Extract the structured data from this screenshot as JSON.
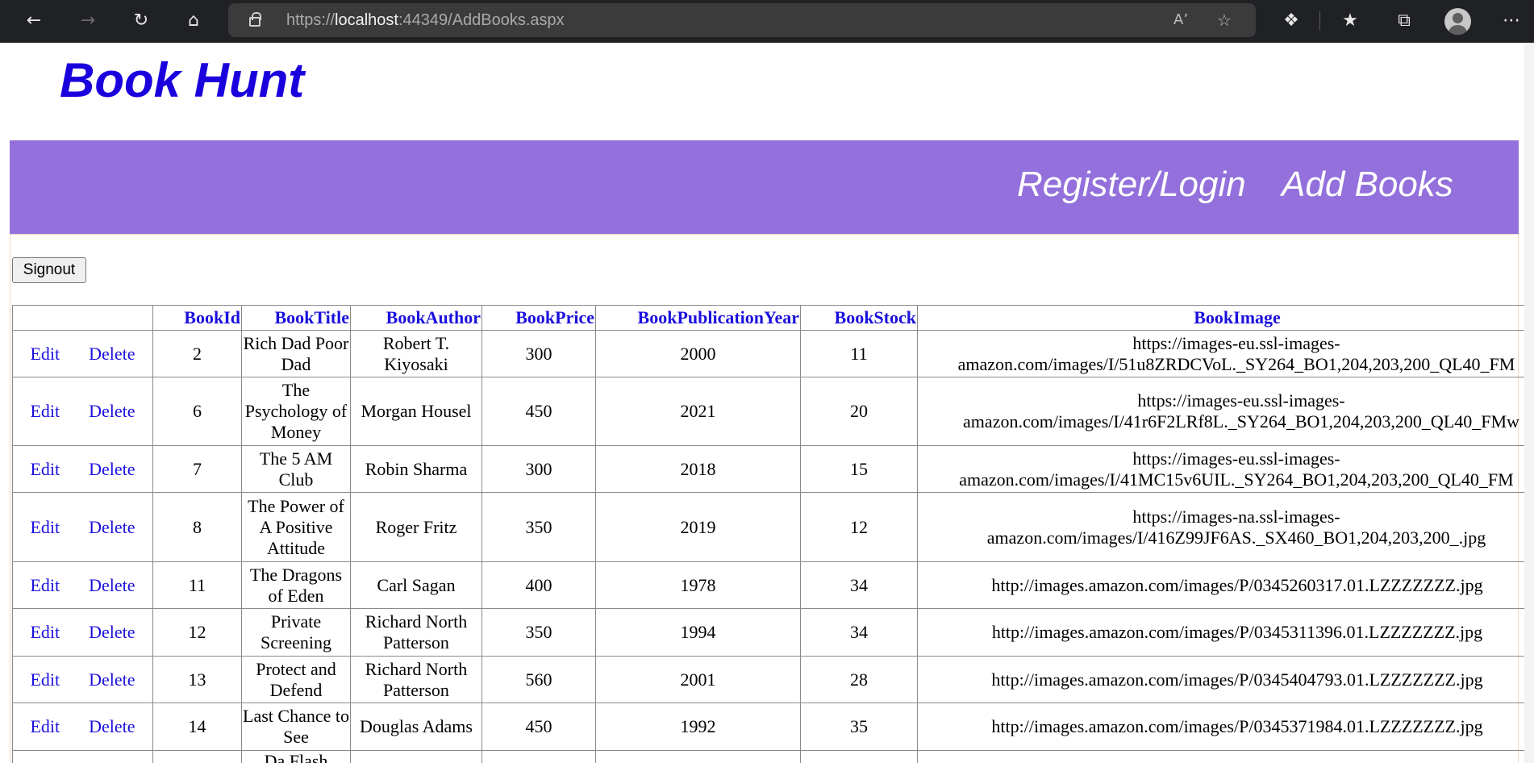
{
  "browser": {
    "url_scheme": "https://",
    "url_host": "localhost",
    "url_rest": ":44349/AddBooks.aspx",
    "icons": [
      "back-icon",
      "forward-icon",
      "refresh-icon",
      "home-icon",
      "lock-icon",
      "read-aloud-icon",
      "add-favorite-icon",
      "extensions-icon",
      "favorites-icon",
      "collections-icon",
      "profile-icon",
      "more-icon"
    ]
  },
  "site": {
    "brand": "Book Hunt",
    "nav": {
      "register_login": "Register/Login",
      "add_books": "Add Books"
    },
    "signout_label": "Signout",
    "colors": {
      "brand": "#1a00dd",
      "nav_band": "#9370db",
      "link": "#1a0fdd"
    }
  },
  "grid": {
    "columns": [
      "",
      "BookId",
      "BookTitle",
      "BookAuthor",
      "BookPrice",
      "BookPublicationYear",
      "BookStock",
      "BookImage"
    ],
    "edit_label": "Edit",
    "delete_label": "Delete",
    "rows": [
      {
        "id": "2",
        "title": "Rich Dad Poor Dad",
        "author": "Robert T. Kiyosaki",
        "price": "300",
        "year": "2000",
        "stock": "11",
        "image": "https://images-eu.ssl-images-amazon.com/images/I/51u8ZRDCVoL._SY264_BO1,204,203,200_QL40_FM"
      },
      {
        "id": "6",
        "title": "The Psychology of Money",
        "author": "Morgan Housel",
        "price": "450",
        "year": "2021",
        "stock": "20",
        "image": "https://images-eu.ssl-images-amazon.com/images/I/41r6F2LRf8L._SY264_BO1,204,203,200_QL40_FMw"
      },
      {
        "id": "7",
        "title": "The 5 AM Club",
        "author": "Robin Sharma",
        "price": "300",
        "year": "2018",
        "stock": "15",
        "image": "https://images-eu.ssl-images-amazon.com/images/I/41MC15v6UIL._SY264_BO1,204,203,200_QL40_FM"
      },
      {
        "id": "8",
        "title": "The Power of A Positive Attitude",
        "author": "Roger Fritz",
        "price": "350",
        "year": "2019",
        "stock": "12",
        "image": "https://images-na.ssl-images-amazon.com/images/I/416Z99JF6AS._SX460_BO1,204,203,200_.jpg"
      },
      {
        "id": "11",
        "title": "The Dragons of Eden",
        "author": "Carl Sagan",
        "price": "400",
        "year": "1978",
        "stock": "34",
        "image": "http://images.amazon.com/images/P/0345260317.01.LZZZZZZZ.jpg"
      },
      {
        "id": "12",
        "title": "Private Screening",
        "author": "Richard North Patterson",
        "price": "350",
        "year": "1994",
        "stock": "34",
        "image": "http://images.amazon.com/images/P/0345311396.01.LZZZZZZZ.jpg"
      },
      {
        "id": "13",
        "title": "Protect and Defend",
        "author": "Richard North Patterson",
        "price": "560",
        "year": "2001",
        "stock": "28",
        "image": "http://images.amazon.com/images/P/0345404793.01.LZZZZZZZ.jpg"
      },
      {
        "id": "14",
        "title": "Last Chance to See",
        "author": "Douglas Adams",
        "price": "450",
        "year": "1992",
        "stock": "35",
        "image": "http://images.amazon.com/images/P/0345371984.01.LZZZZZZZ.jpg"
      },
      {
        "id": "",
        "title": "Da Flash",
        "author": "",
        "price": "",
        "year": "",
        "stock": "",
        "image": ""
      }
    ]
  }
}
